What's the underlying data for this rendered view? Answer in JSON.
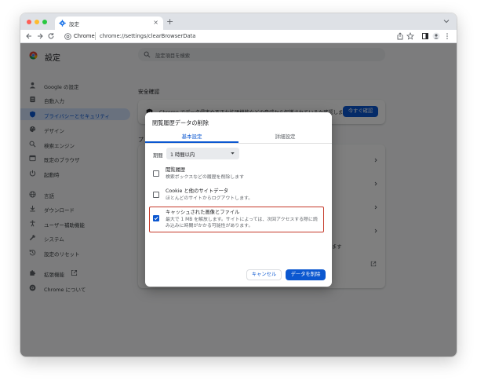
{
  "browser": {
    "tab_title": "設定",
    "omnibox_chip": "Chrome",
    "omnibox_url": "chrome://settings/clearBrowserData"
  },
  "settings": {
    "page_title": "設定",
    "search_placeholder": "設定項目を検索",
    "nav_items": [
      {
        "label": "Google の設定",
        "icon": "person-icon"
      },
      {
        "label": "自動入力",
        "icon": "autofill-icon"
      },
      {
        "label": "プライバシーとセキュリティ",
        "icon": "shield-icon",
        "active": true
      },
      {
        "label": "デザイン",
        "icon": "palette-icon"
      },
      {
        "label": "検索エンジン",
        "icon": "search-icon"
      },
      {
        "label": "既定のブラウザ",
        "icon": "browser-icon"
      },
      {
        "label": "起動時",
        "icon": "power-icon"
      },
      {
        "label": "言語",
        "icon": "globe-icon"
      },
      {
        "label": "ダウンロード",
        "icon": "download-icon"
      },
      {
        "label": "ユーザー補助機能",
        "icon": "accessibility-icon"
      },
      {
        "label": "システム",
        "icon": "wrench-icon"
      },
      {
        "label": "設定のリセット",
        "icon": "reset-icon"
      },
      {
        "label": "拡張機能",
        "icon": "puzzle-icon"
      },
      {
        "label": "Chrome について",
        "icon": "chrome-icon"
      }
    ],
    "safety_check": {
      "title": "安全確認",
      "text": "Chrome でデータ侵害や不正な拡張機能などの脅威から保護されているか確認します",
      "button": "今すぐ確認"
    },
    "privacy_section_partial": "プ",
    "partial_row_text": "ます"
  },
  "dialog": {
    "title": "閲覧履歴データの削除",
    "tabs": [
      "基本設定",
      "詳細設定"
    ],
    "active_tab": "基本設定",
    "period_label": "期間",
    "period_value": "1 時間以内",
    "options": [
      {
        "title": "閲覧履歴",
        "subtitle": "検索ボックスなどの履歴を削除します",
        "checked": false
      },
      {
        "title": "Cookie と他のサイトデータ",
        "subtitle": "ほとんどのサイトからログアウトします。",
        "checked": false
      },
      {
        "title": "キャッシュされた画像とファイル",
        "subtitle": "最大で 1 MB を解放します。サイトによっては、次回アクセスする際に読",
        "subtitle2": "み込みに時間がかかる可能性があります。",
        "checked": true
      }
    ],
    "cancel_label": "キャンセル",
    "delete_label": "データを削除"
  },
  "colors": {
    "accent": "#0b57d0",
    "highlight": "#c53929"
  }
}
